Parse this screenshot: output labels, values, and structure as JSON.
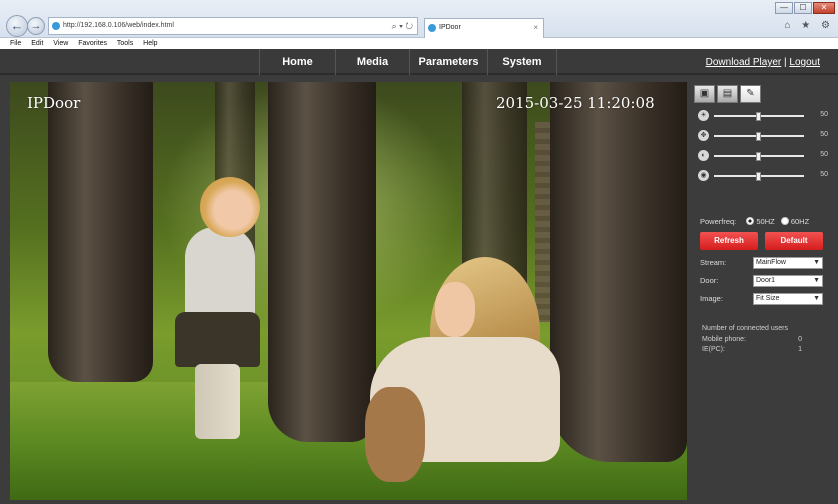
{
  "browser": {
    "url": "http://192.168.0.106/web/index.html",
    "tab_title": "IPDoor",
    "tab_close": "×",
    "back_icon": "←",
    "forward_icon": "→",
    "address_tools": "⌕ ▾ ↻",
    "right_icons": "⌂ ★ ⚙",
    "window_controls": {
      "minimize": "—",
      "maximize": "☐",
      "close": "✕"
    }
  },
  "menu": [
    "File",
    "Edit",
    "View",
    "Favorites",
    "Tools",
    "Help"
  ],
  "nav": {
    "items": [
      "Home",
      "Media",
      "Parameters",
      "System"
    ],
    "download_player": "Download Player",
    "separator": "|",
    "logout": "Logout"
  },
  "video": {
    "title": "IPDoor",
    "timestamp": "2015-03-25 11:20:08"
  },
  "panel": {
    "tools": [
      {
        "name": "snapshot-icon",
        "glyph": "▣"
      },
      {
        "name": "record-icon",
        "glyph": "▤"
      },
      {
        "name": "settings-icon",
        "glyph": "✎"
      }
    ],
    "sliders": [
      {
        "icon": "☀",
        "name": "brightness-slider",
        "value": 50
      },
      {
        "icon": "✥",
        "name": "contrast-slider",
        "value": 50
      },
      {
        "icon": "◐",
        "name": "saturation-slider",
        "value": 50
      },
      {
        "icon": "◉",
        "name": "hue-slider",
        "value": 50
      }
    ],
    "powerfreq_label": "Powerfreq:",
    "option_50": "50HZ",
    "option_60": "60HZ",
    "selected_freq": "50HZ",
    "refresh": "Refresh",
    "default": "Default",
    "stream_label": "Stream:",
    "stream_value": "MainFlow",
    "door_label": "Door:",
    "door_value": "Door1",
    "image_label": "Image:",
    "image_value": "Fit Size",
    "connected_title": "Number of connected users",
    "mobile_label": "Mobile phone:",
    "mobile_value": "0",
    "pc_label": "IE(PC):",
    "pc_value": "1"
  },
  "colors": {
    "accent_red": "#e83030",
    "panel_bg": "#3c3c3c"
  }
}
